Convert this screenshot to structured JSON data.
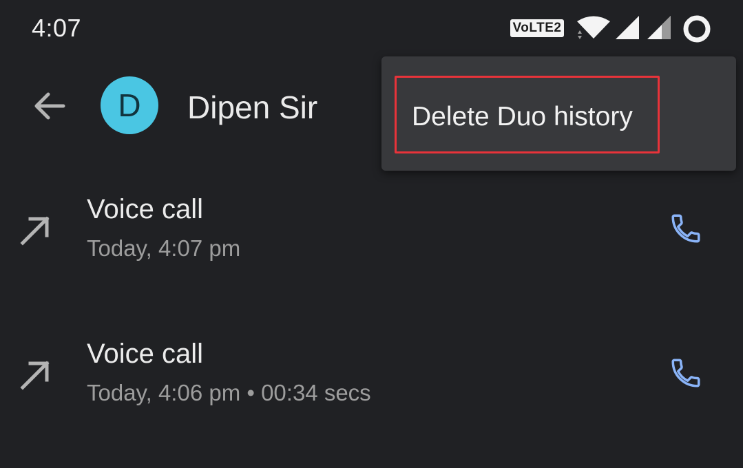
{
  "status_bar": {
    "time": "4:07",
    "network_badge": "VoLTE2",
    "icons": [
      "wifi-icon",
      "signal-icon",
      "signal-icon",
      "battery-icon"
    ]
  },
  "toolbar": {
    "back_icon": "back-arrow-icon",
    "avatar_letter": "D",
    "contact_name": "Dipen Sir"
  },
  "overflow_menu": {
    "items": [
      {
        "label": "Delete Duo history"
      }
    ]
  },
  "call_log": [
    {
      "icon": "outgoing-call-icon",
      "title": "Voice call",
      "detail": "Today, 4:07 pm",
      "action_icon": "phone-icon"
    },
    {
      "icon": "outgoing-call-icon",
      "title": "Voice call",
      "detail": "Today, 4:06 pm • 00:34 secs",
      "action_icon": "phone-icon"
    }
  ],
  "colors": {
    "background": "#202124",
    "avatar": "#4ac6e3",
    "phone_icon": "#8ab4f8",
    "menu_background": "#38393c",
    "highlight_border": "#e8333a"
  }
}
